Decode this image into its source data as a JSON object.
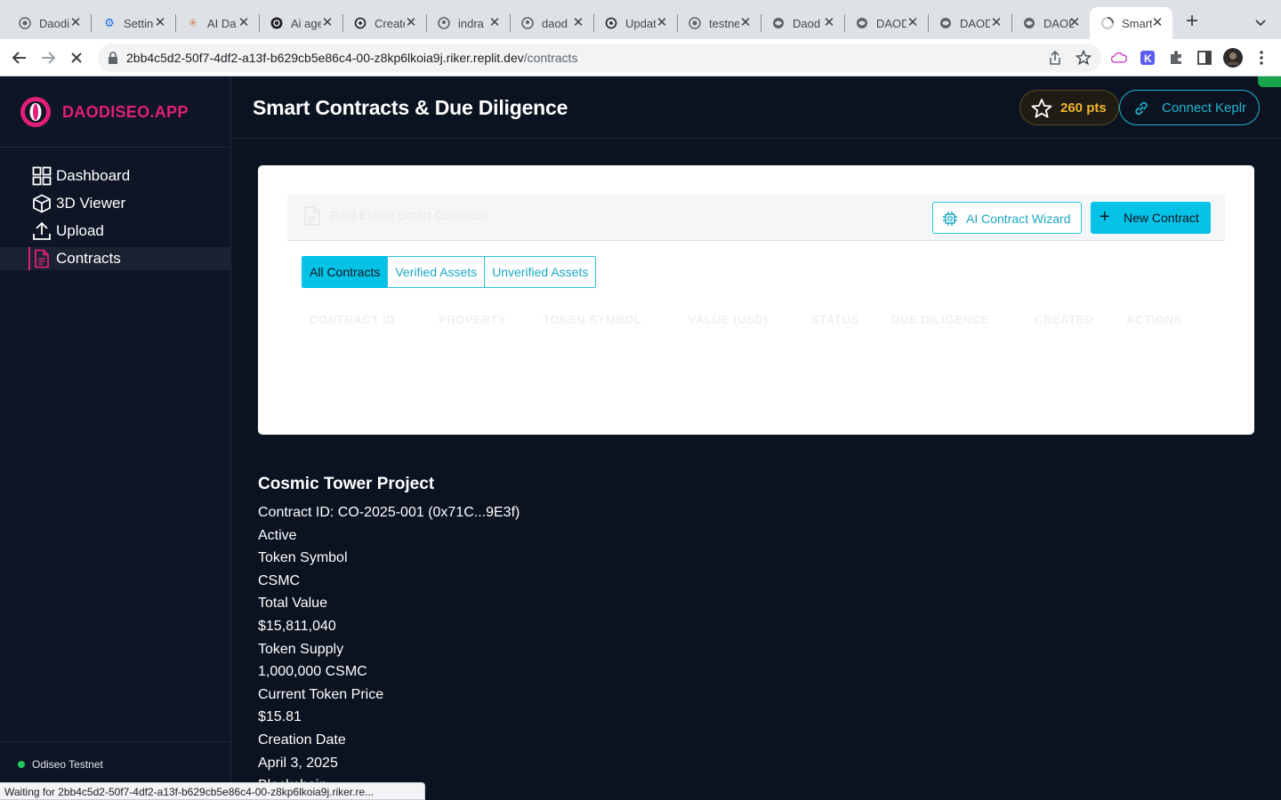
{
  "browser": {
    "tabs": [
      {
        "title": "Daodiseo",
        "icon": "globe-icon"
      },
      {
        "title": "Settings",
        "icon": "gear-icon"
      },
      {
        "title": "AI Da",
        "icon": "asterisk-icon"
      },
      {
        "title": "Ai agent",
        "icon": "openai-icon"
      },
      {
        "title": "Create",
        "icon": "circle-icon"
      },
      {
        "title": "indra",
        "icon": "github-icon"
      },
      {
        "title": "daod",
        "icon": "github-icon"
      },
      {
        "title": "Update",
        "icon": "circle-icon"
      },
      {
        "title": "testnet",
        "icon": "globe-icon"
      },
      {
        "title": "Daod",
        "icon": "globe-icon"
      },
      {
        "title": "DAOD",
        "icon": "globe-icon"
      },
      {
        "title": "DAOD",
        "icon": "globe-icon"
      },
      {
        "title": "DAOD",
        "icon": "globe-icon"
      },
      {
        "title": "Smart",
        "icon": "loading-icon",
        "active": true
      }
    ],
    "url_host": "2bb4c5d2-50f7-4df2-a13f-b629cb5e86c4-00-z8kp6lkoia9j.riker.replit.dev",
    "url_path": "/contracts",
    "status_text": "Waiting for 2bb4c5d2-50f7-4df2-a13f-b629cb5e86c4-00-z8kp6lkoia9j.riker.re..."
  },
  "app": {
    "brand": "DAODISEO.APP",
    "nav": [
      {
        "label": "Dashboard",
        "icon": "grid-icon"
      },
      {
        "label": "3D Viewer",
        "icon": "cube-icon"
      },
      {
        "label": "Upload",
        "icon": "upload-icon"
      },
      {
        "label": "Contracts",
        "icon": "document-icon",
        "active": true
      }
    ],
    "network": "Odiseo Testnet",
    "page_title": "Smart Contracts & Due Diligence",
    "points": "260 pts",
    "connect_label": "Connect Keplr",
    "colors": {
      "accent": "#05c3e6",
      "brand": "#e01f7a",
      "points": "#f0b429"
    }
  },
  "contracts_card": {
    "header_text": "Real Estate Smart Contracts",
    "wizard_label": "AI Contract Wizard",
    "new_label": "New Contract",
    "filter_tabs": [
      "All Contracts",
      "Verified Assets",
      "Unverified Assets"
    ],
    "columns": [
      "CONTRACT ID",
      "PROPERTY",
      "TOKEN SYMBOL",
      "VALUE (USD)",
      "STATUS",
      "DUE DILIGENCE",
      "CREATED",
      "ACTIONS"
    ]
  },
  "detail": {
    "title": "Cosmic Tower Project",
    "lines": [
      "Contract ID: CO-2025-001 (0x71C...9E3f)",
      "Active",
      "Token Symbol",
      "CSMC",
      "Total Value",
      "$15,811,040",
      "Token Supply",
      "1,000,000 CSMC",
      "Current Token Price",
      "$15.81",
      "Creation Date",
      "April 3, 2025",
      "Blockchain"
    ]
  }
}
